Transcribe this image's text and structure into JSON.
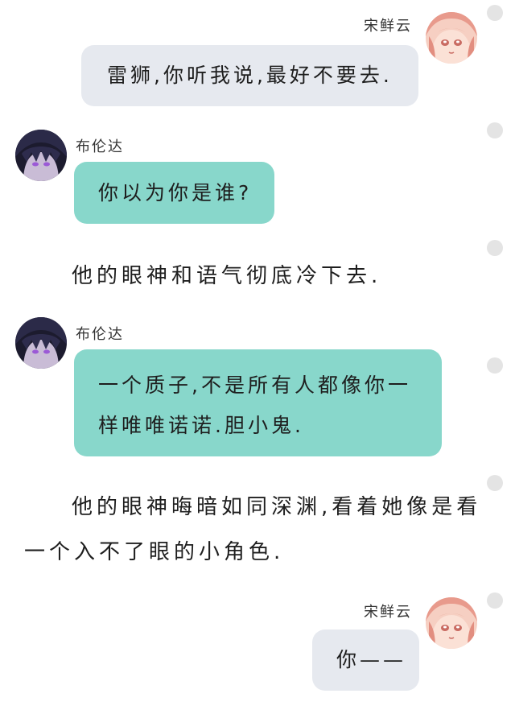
{
  "characters": {
    "song": {
      "name": "宋鲜云",
      "avatar_icon": "pink-haired-girl-avatar-icon",
      "avatar_color": "#f2b3a4"
    },
    "bu": {
      "name": "布伦达",
      "avatar_icon": "dark-haired-boy-avatar-icon",
      "avatar_color": "#23223a"
    }
  },
  "colors": {
    "bubble_grey": "#e6e9ef",
    "bubble_teal": "#88d7cb",
    "dot": "#e4e4e4"
  },
  "messages": [
    {
      "speaker": "宋鲜云",
      "text": "雷狮,你听我说,最好不要去."
    },
    {
      "speaker": "布伦达",
      "text": "你以为你是谁?"
    },
    {
      "narration": "他的眼神和语气彻底冷下去."
    },
    {
      "speaker": "布伦达",
      "line1": "一个质子,不是所有人都像你一",
      "line2": "样唯唯诺诺.胆小鬼."
    },
    {
      "narration_line1": "他的眼神晦暗如同深渊,看着她像是看",
      "narration_line2": "一个入不了眼的小角色."
    },
    {
      "speaker": "宋鲜云",
      "text": "你——"
    }
  ]
}
